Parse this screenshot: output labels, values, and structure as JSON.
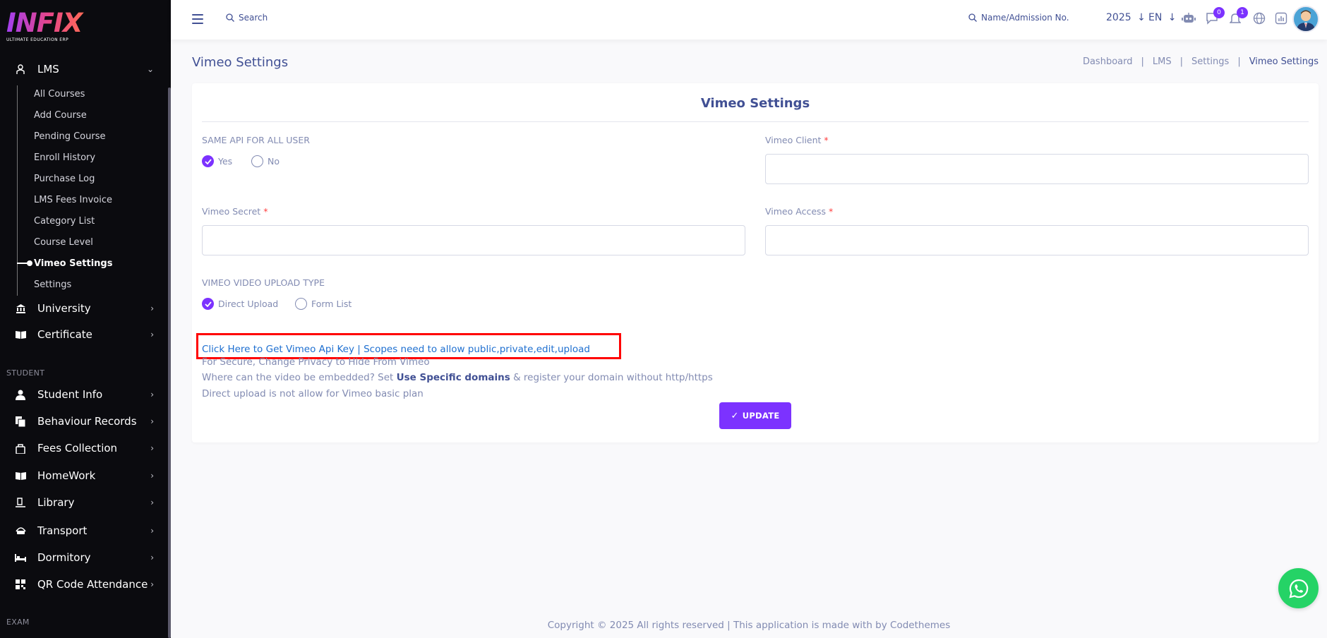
{
  "brand": {
    "logo_text": "INFIX",
    "logo_sub": "ULTIMATE EDUCATION ERP"
  },
  "sidebar": {
    "lms": {
      "label": "LMS",
      "icon": "lms-icon"
    },
    "lms_items": [
      {
        "label": "All Courses"
      },
      {
        "label": "Add Course"
      },
      {
        "label": "Pending Course"
      },
      {
        "label": "Enroll History"
      },
      {
        "label": "Purchase Log"
      },
      {
        "label": "LMS Fees Invoice"
      },
      {
        "label": "Category List"
      },
      {
        "label": "Course Level"
      },
      {
        "label": "Vimeo Settings",
        "active": true
      },
      {
        "label": "Settings"
      }
    ],
    "university": {
      "label": "University",
      "icon": "university-icon"
    },
    "certificate": {
      "label": "Certificate",
      "icon": "certificate-icon"
    },
    "student_section": "STUDENT",
    "student_items": [
      {
        "label": "Student Info",
        "icon": "student-icon"
      },
      {
        "label": "Behaviour Records",
        "icon": "records-icon"
      },
      {
        "label": "Fees Collection",
        "icon": "fees-icon"
      },
      {
        "label": "HomeWork",
        "icon": "book-icon"
      },
      {
        "label": "Library",
        "icon": "library-icon"
      },
      {
        "label": "Transport",
        "icon": "transport-icon"
      },
      {
        "label": "Dormitory",
        "icon": "bed-icon"
      },
      {
        "label": "QR Code Attendance",
        "icon": "qr-icon"
      }
    ],
    "exam_section": "EXAM"
  },
  "header": {
    "search": "Search",
    "student_search": "Name/Admission No.",
    "year": "2025",
    "lang": "EN",
    "chat_badge": "0",
    "notif_badge": "1"
  },
  "page": {
    "title": "Vimeo Settings",
    "breadcrumb": [
      "Dashboard",
      "LMS",
      "Settings",
      "Vimeo Settings"
    ]
  },
  "form": {
    "title": "Vimeo Settings",
    "same_api_label": "SAME API FOR ALL USER",
    "same_api_yes": "Yes",
    "same_api_no": "No",
    "same_api_value": "Yes",
    "vimeo_client_label": "Vimeo Client",
    "vimeo_client_value": "",
    "vimeo_secret_label": "Vimeo Secret",
    "vimeo_secret_value": "",
    "vimeo_access_label": "Vimeo Access",
    "vimeo_access_value": "",
    "required_mark": "*",
    "upload_type_label": "VIMEO VIDEO UPLOAD TYPE",
    "upload_direct": "Direct Upload",
    "upload_form": "Form List",
    "upload_value": "Direct Upload",
    "api_link": "Click Here to Get Vimeo Api Key | Scopes need to allow public,private,edit,upload",
    "note1": "For Secure, Change Privacy to Hide From Vimeo",
    "note2_pre": "Where can the video be embedded? Set ",
    "note2_bold": "Use Specific domains",
    "note2_post": " & register your domain without http/https",
    "note3": "Direct upload is not allow for Vimeo basic plan",
    "update_label": "UPDATE"
  },
  "footer": "Copyright © 2025 All rights reserved | This application is made with by Codethemes",
  "colors": {
    "primary": "#7c32ff",
    "text": "#415094",
    "muted": "#828bb2",
    "sidebar_bg": "#0b0b0f",
    "whatsapp": "#25d366",
    "highlight": "#ff0000"
  }
}
